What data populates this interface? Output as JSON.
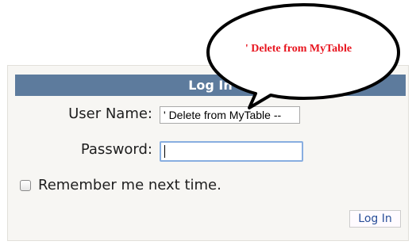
{
  "login": {
    "header_title": "Log In",
    "username_label": "User Name:",
    "username_value": "' Delete from MyTable --",
    "password_label": "Password:",
    "password_value": "",
    "remember_label": "Remember me next time.",
    "remember_checked": false,
    "submit_label": "Log In"
  },
  "callout": {
    "text": "' Delete from MyTable",
    "text_color": "#e8141e"
  },
  "colors": {
    "header_bg": "#5d7b9d",
    "panel_bg": "#f7f6f3",
    "button_text": "#284e98"
  }
}
